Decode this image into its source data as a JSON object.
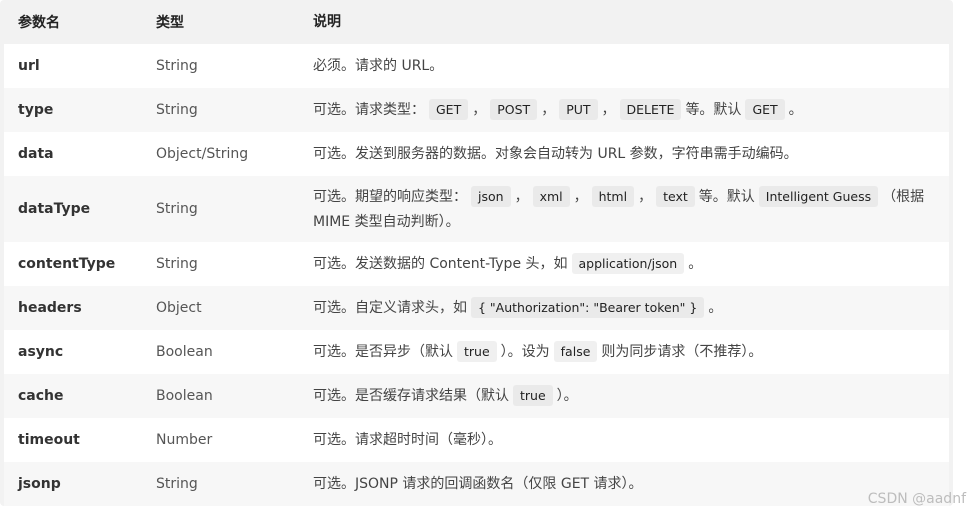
{
  "headers": [
    "参数名",
    "类型",
    "说明"
  ],
  "rows": [
    {
      "name": "url",
      "type": "String",
      "desc": [
        {
          "t": "必须。请求的 URL。"
        }
      ]
    },
    {
      "name": "type",
      "type": "String",
      "desc": [
        {
          "t": "可选。请求类型："
        },
        {
          "c": "GET"
        },
        {
          "t": "，"
        },
        {
          "c": "POST"
        },
        {
          "t": "，"
        },
        {
          "c": "PUT"
        },
        {
          "t": "，"
        },
        {
          "c": "DELETE"
        },
        {
          "t": "等。默认"
        },
        {
          "c": "GET"
        },
        {
          "t": "。"
        }
      ]
    },
    {
      "name": "data",
      "type": "Object/String",
      "desc": [
        {
          "t": "可选。发送到服务器的数据。对象会自动转为 URL 参数，字符串需手动编码。"
        }
      ]
    },
    {
      "name": "dataType",
      "type": "String",
      "desc": [
        {
          "t": "可选。期望的响应类型："
        },
        {
          "c": "json"
        },
        {
          "t": "，"
        },
        {
          "c": "xml"
        },
        {
          "t": "，"
        },
        {
          "c": "html"
        },
        {
          "t": "，"
        },
        {
          "c": "text"
        },
        {
          "t": "等。默认"
        },
        {
          "c": "Intelligent Guess"
        },
        {
          "t": "（根据 MIME 类型自动判断）。"
        }
      ]
    },
    {
      "name": "contentType",
      "type": "String",
      "desc": [
        {
          "t": "可选。发送数据的 Content-Type 头，如"
        },
        {
          "c": "application/json"
        },
        {
          "t": "。"
        }
      ]
    },
    {
      "name": "headers",
      "type": "Object",
      "desc": [
        {
          "t": "可选。自定义请求头，如"
        },
        {
          "c": "{ \"Authorization\": \"Bearer token\" }"
        },
        {
          "t": "。"
        }
      ]
    },
    {
      "name": "async",
      "type": "Boolean",
      "desc": [
        {
          "t": "可选。是否异步（默认"
        },
        {
          "c": "true"
        },
        {
          "t": "）。设为"
        },
        {
          "c": "false"
        },
        {
          "t": "则为同步请求（不推荐）。"
        }
      ]
    },
    {
      "name": "cache",
      "type": "Boolean",
      "desc": [
        {
          "t": "可选。是否缓存请求结果（默认"
        },
        {
          "c": "true"
        },
        {
          "t": "）。"
        }
      ]
    },
    {
      "name": "timeout",
      "type": "Number",
      "desc": [
        {
          "t": "可选。请求超时时间（毫秒）。"
        }
      ]
    },
    {
      "name": "jsonp",
      "type": "String",
      "desc": [
        {
          "t": "可选。JSONP 请求的回调函数名（仅限 GET 请求）。"
        }
      ]
    }
  ],
  "watermark": "CSDN @aadnf"
}
